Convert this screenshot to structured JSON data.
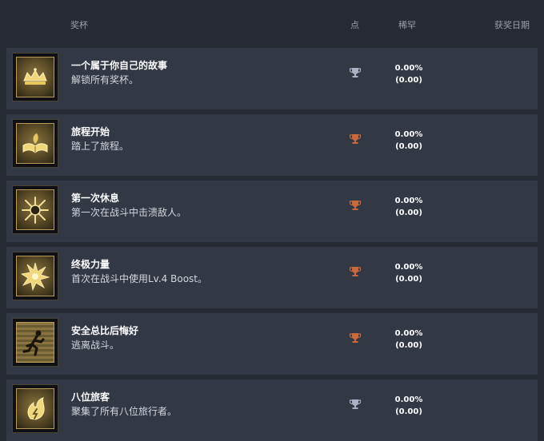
{
  "header": {
    "trophy": "奖杯",
    "points": "点",
    "rarity": "稀罕",
    "date": "获奖日期"
  },
  "colors": {
    "silver": "#a9b1c4",
    "bronze": "#c9693c"
  },
  "trophies": [
    {
      "name": "一个属于你自己的故事",
      "desc": "解锁所有奖杯。",
      "percent": "0.00%",
      "ratio": "(0.00)",
      "grade": "silver",
      "icon": "crown-icon"
    },
    {
      "name": "旅程开始",
      "desc": "踏上了旅程。",
      "percent": "0.00%",
      "ratio": "(0.00)",
      "grade": "bronze",
      "icon": "open-book-icon"
    },
    {
      "name": "第一次休息",
      "desc": "第一次在战斗中击溃敌人。",
      "percent": "0.00%",
      "ratio": "(0.00)",
      "grade": "bronze",
      "icon": "shatter-burst-icon"
    },
    {
      "name": "终极力量",
      "desc": "首次在战斗中使用Lv.4 Boost。",
      "percent": "0.00%",
      "ratio": "(0.00)",
      "grade": "bronze",
      "icon": "starburst-icon"
    },
    {
      "name": "安全总比后悔好",
      "desc": "逃离战斗。",
      "percent": "0.00%",
      "ratio": "(0.00)",
      "grade": "bronze",
      "icon": "running-figure-icon"
    },
    {
      "name": "八位旅客",
      "desc": "聚集了所有八位旅行者。",
      "percent": "0.00%",
      "ratio": "(0.00)",
      "grade": "silver",
      "icon": "flame-emblem-icon"
    }
  ]
}
